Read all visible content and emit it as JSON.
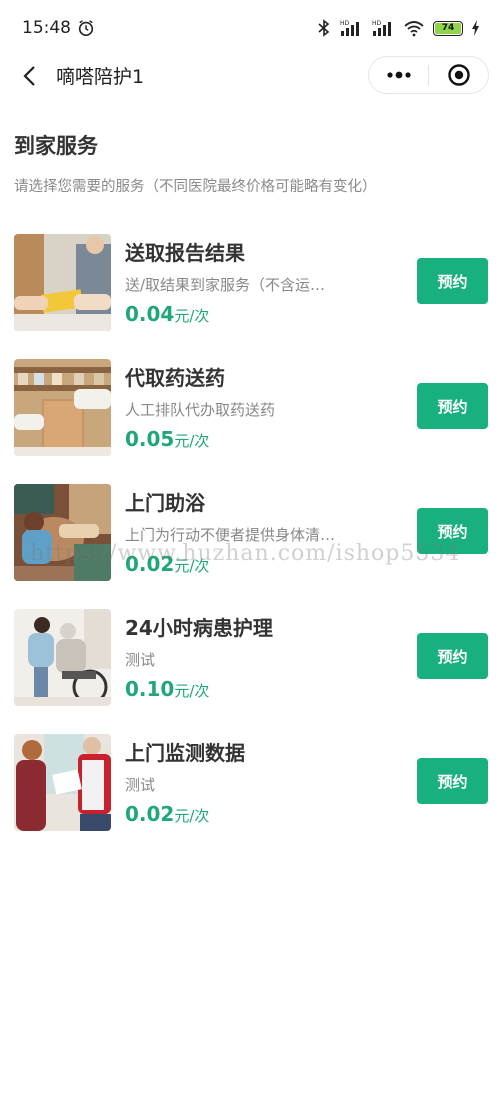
{
  "status_bar": {
    "time": "15:48",
    "battery": "74",
    "icons": [
      "alarm-icon",
      "bluetooth-icon",
      "signal-hd-icon",
      "signal-hd-icon",
      "wifi-icon",
      "battery-icon",
      "charging-icon"
    ]
  },
  "nav": {
    "title": "嘀嗒陪护1",
    "back_icon": "back-chevron-icon",
    "more_icon": "more-dots-icon",
    "close_icon": "target-circle-icon"
  },
  "section": {
    "title": "到家服务",
    "subtitle": "请选择您需要的服务（不同医院最终价格可能略有变化）"
  },
  "services": [
    {
      "title": "送取报告结果",
      "desc": "送/取结果到家服务（不含运…",
      "price": "0.04",
      "unit": "元/次",
      "button": "预约",
      "image": "report-delivery-photo"
    },
    {
      "title": "代取药送药",
      "desc": "人工排队代办取药送药",
      "price": "0.05",
      "unit": "元/次",
      "button": "预约",
      "image": "medicine-pickup-photo"
    },
    {
      "title": "上门助浴",
      "desc": "上门为行动不便者提供身体清…",
      "price": "0.02",
      "unit": "元/次",
      "button": "预约",
      "image": "bathing-assist-photo"
    },
    {
      "title": "24小时病患护理",
      "desc": "测试",
      "price": "0.10",
      "unit": "元/次",
      "button": "预约",
      "image": "patient-care-photo"
    },
    {
      "title": "上门监测数据",
      "desc": "测试",
      "price": "0.02",
      "unit": "元/次",
      "button": "预约",
      "image": "home-monitoring-photo"
    }
  ],
  "watermark": "https://www.huzhan.com/ishop5534",
  "colors": {
    "accent": "#18b07f",
    "price": "#1fa67a"
  }
}
